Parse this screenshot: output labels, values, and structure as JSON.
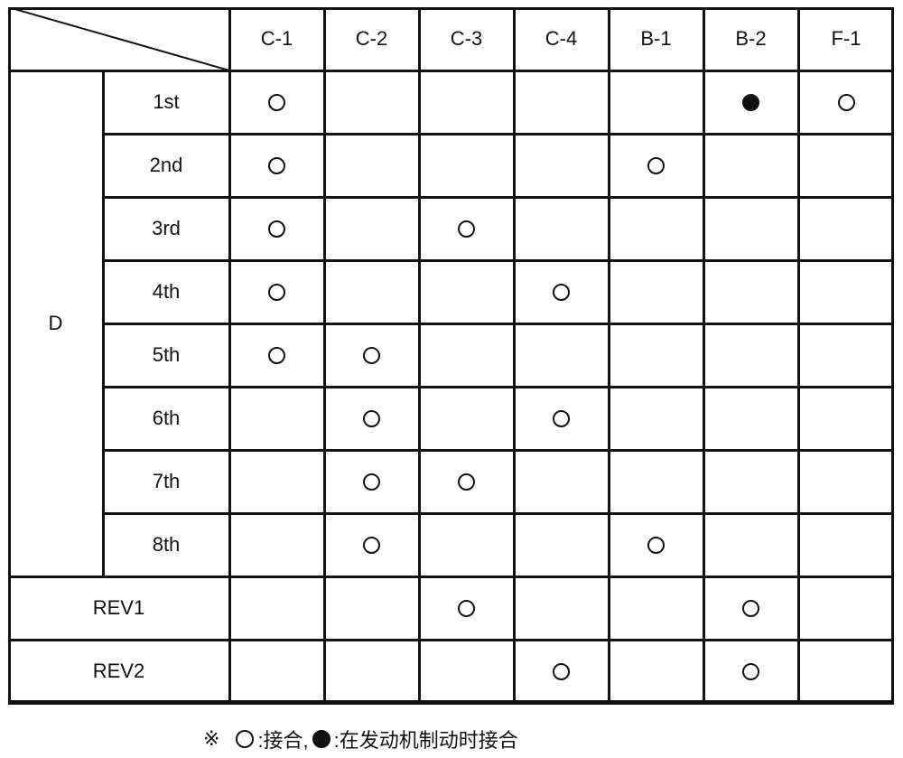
{
  "table": {
    "columns": [
      "C-1",
      "C-2",
      "C-3",
      "C-4",
      "B-1",
      "B-2",
      "F-1"
    ],
    "group_label": "D",
    "rows": [
      {
        "label": "1st",
        "group": "D",
        "cells": [
          "open",
          "",
          "",
          "",
          "",
          "filled",
          "open"
        ]
      },
      {
        "label": "2nd",
        "group": "D",
        "cells": [
          "open",
          "",
          "",
          "",
          "open",
          "",
          ""
        ]
      },
      {
        "label": "3rd",
        "group": "D",
        "cells": [
          "open",
          "",
          "open",
          "",
          "",
          "",
          ""
        ]
      },
      {
        "label": "4th",
        "group": "D",
        "cells": [
          "open",
          "",
          "",
          "open",
          "",
          "",
          ""
        ]
      },
      {
        "label": "5th",
        "group": "D",
        "cells": [
          "open",
          "open",
          "",
          "",
          "",
          "",
          ""
        ]
      },
      {
        "label": "6th",
        "group": "D",
        "cells": [
          "",
          "open",
          "",
          "open",
          "",
          "",
          ""
        ]
      },
      {
        "label": "7th",
        "group": "D",
        "cells": [
          "",
          "open",
          "open",
          "",
          "",
          "",
          ""
        ]
      },
      {
        "label": "8th",
        "group": "D",
        "cells": [
          "",
          "open",
          "",
          "",
          "open",
          "",
          ""
        ]
      },
      {
        "label": "REV1",
        "group": "",
        "cells": [
          "",
          "",
          "open",
          "",
          "",
          "open",
          ""
        ]
      },
      {
        "label": "REV2",
        "group": "",
        "cells": [
          "",
          "",
          "",
          "open",
          "",
          "open",
          ""
        ]
      }
    ]
  },
  "legend": {
    "prefix": "※",
    "open_label": ":接合,",
    "filled_label": ":在发动机制动时接合"
  }
}
